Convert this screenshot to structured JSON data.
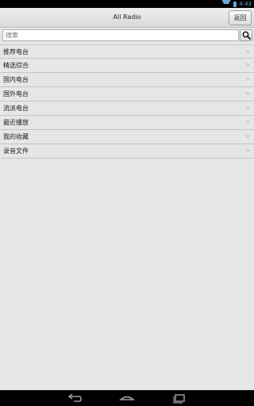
{
  "status_bar": {
    "time": "4:43",
    "icons": [
      "signal-icon",
      "battery-icon"
    ]
  },
  "header": {
    "title": "All Radio",
    "back_label": "返回"
  },
  "search": {
    "placeholder": "搜索",
    "button_icon": "search-icon"
  },
  "menu": {
    "items": [
      {
        "label": "推荐电台",
        "chevron": ">"
      },
      {
        "label": "精选综合",
        "chevron": ">"
      },
      {
        "label": "国内电台",
        "chevron": ">"
      },
      {
        "label": "国外电台",
        "chevron": ">"
      },
      {
        "label": "流派电台",
        "chevron": ">"
      },
      {
        "label": "最近播放",
        "chevron": ">"
      },
      {
        "label": "我的收藏",
        "chevron": ">"
      },
      {
        "label": "录音文件",
        "chevron": ">"
      }
    ]
  },
  "nav_bar": {
    "buttons": [
      "back-icon",
      "home-icon",
      "recents-icon"
    ]
  },
  "colors": {
    "status_accent": "#6aa9d0",
    "background": "#e6e6e6",
    "divider": "#c4c4c4"
  }
}
